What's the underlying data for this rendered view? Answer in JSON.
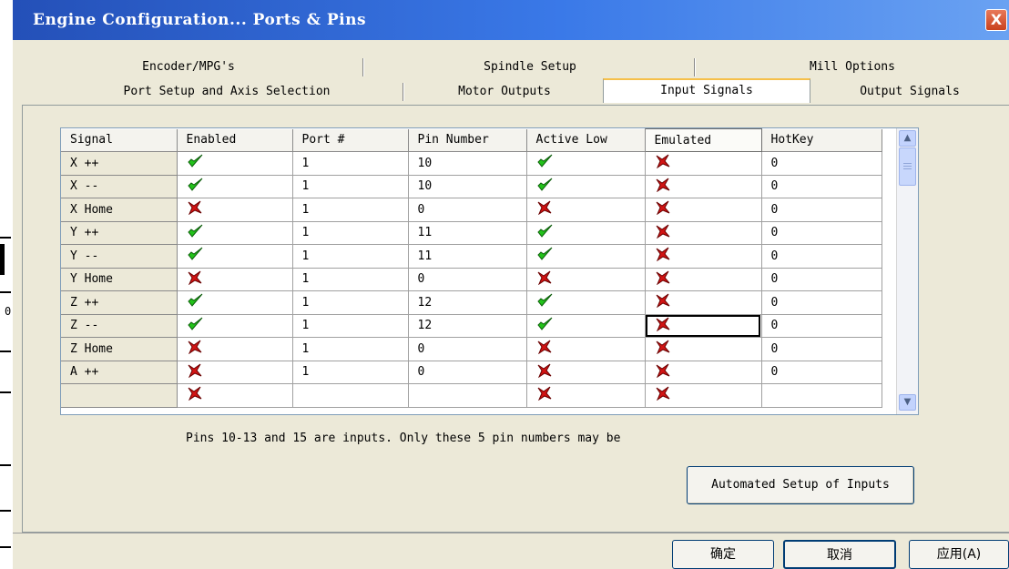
{
  "window": {
    "title": "Engine Configuration... Ports & Pins",
    "close_label": "X"
  },
  "tabs_back": [
    {
      "label": "Encoder/MPG's"
    },
    {
      "label": "Spindle Setup"
    },
    {
      "label": "Mill Options"
    }
  ],
  "tabs_front": [
    {
      "label": "Port Setup and Axis Selection"
    },
    {
      "label": "Motor Outputs"
    },
    {
      "label": "Input Signals",
      "active": true
    },
    {
      "label": "Output Signals"
    }
  ],
  "table": {
    "columns": [
      "Signal",
      "Enabled",
      "Port #",
      "Pin Number",
      "Active Low",
      "Emulated",
      "HotKey"
    ],
    "rows": [
      {
        "signal": "X ++",
        "enabled": true,
        "port": "1",
        "pin": "10",
        "active_low": true,
        "emulated": false,
        "hotkey": "0"
      },
      {
        "signal": "X --",
        "enabled": true,
        "port": "1",
        "pin": "10",
        "active_low": true,
        "emulated": false,
        "hotkey": "0"
      },
      {
        "signal": "X Home",
        "enabled": false,
        "port": "1",
        "pin": "0",
        "active_low": false,
        "emulated": false,
        "hotkey": "0"
      },
      {
        "signal": "Y ++",
        "enabled": true,
        "port": "1",
        "pin": "11",
        "active_low": true,
        "emulated": false,
        "hotkey": "0"
      },
      {
        "signal": "Y --",
        "enabled": true,
        "port": "1",
        "pin": "11",
        "active_low": true,
        "emulated": false,
        "hotkey": "0"
      },
      {
        "signal": "Y Home",
        "enabled": false,
        "port": "1",
        "pin": "0",
        "active_low": false,
        "emulated": false,
        "hotkey": "0"
      },
      {
        "signal": "Z ++",
        "enabled": true,
        "port": "1",
        "pin": "12",
        "active_low": true,
        "emulated": false,
        "hotkey": "0"
      },
      {
        "signal": "Z --",
        "enabled": true,
        "port": "1",
        "pin": "12",
        "active_low": true,
        "emulated": false,
        "hotkey": "0",
        "focused": true
      },
      {
        "signal": "Z Home",
        "enabled": false,
        "port": "1",
        "pin": "0",
        "active_low": false,
        "emulated": false,
        "hotkey": "0"
      },
      {
        "signal": "A ++",
        "enabled": false,
        "port": "1",
        "pin": "0",
        "active_low": false,
        "emulated": false,
        "hotkey": "0"
      },
      {
        "signal": "",
        "enabled": false,
        "port": "",
        "pin": "",
        "active_low": false,
        "emulated": false,
        "hotkey": ""
      }
    ]
  },
  "note": "Pins 10-13 and 15 are inputs. Only these 5 pin numbers may be",
  "auto_button": "Automated Setup of Inputs",
  "dialog_buttons": {
    "ok": "确定",
    "cancel": "取消",
    "apply": "应用(A)"
  },
  "edge_text": "0",
  "icons": {
    "check": "check-icon",
    "cross": "cross-icon",
    "scroll_up": "scroll-up-icon",
    "scroll_down": "scroll-down-icon"
  },
  "colors": {
    "check": "#22c21a",
    "cross": "#d21414",
    "title_bar": "#2450b8",
    "active_tab_border": "#f6c04a"
  }
}
